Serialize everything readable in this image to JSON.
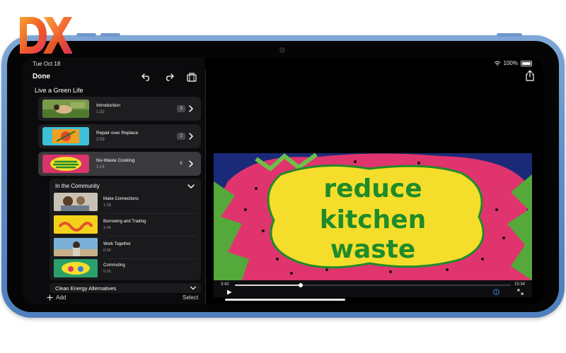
{
  "logo": {
    "text": "DX",
    "colors": [
      "#f0592a",
      "#f7a12b",
      "#e8365d"
    ]
  },
  "status": {
    "time": "Tue Oct 18",
    "battery": "100%"
  },
  "nav": {
    "done_label": "Done"
  },
  "project": {
    "title": "Live a Green Life"
  },
  "chapters": [
    {
      "name": "Introduction",
      "duration": "1:32",
      "count": "3"
    },
    {
      "name": "Repair over Replace",
      "duration": "2:09",
      "count": "2"
    },
    {
      "name": "No-Waste Cooking",
      "duration": "3:14",
      "count": "6"
    }
  ],
  "community": {
    "title": "In the Community",
    "items": [
      {
        "name": "Make Connections",
        "duration": "1:28"
      },
      {
        "name": "Borrowing and Trading",
        "duration": "1:04"
      },
      {
        "name": "Work Together",
        "duration": "0:58"
      },
      {
        "name": "Commuting",
        "duration": "0:26"
      }
    ]
  },
  "clean_energy": {
    "title": "Clean Energy Alternatives"
  },
  "bottom": {
    "add_label": "Add",
    "select_label": "Select"
  },
  "video": {
    "title_lines": [
      "reduce",
      "kitchen",
      "waste"
    ],
    "elapsed": "3:42",
    "total": "15:34",
    "progress": 0.238
  },
  "colors": {
    "device": "#5f8fc8",
    "accent_video_text": "#1f8b2a",
    "video_blob": "#f4de2b",
    "dragonfruit": "#e0346e"
  }
}
